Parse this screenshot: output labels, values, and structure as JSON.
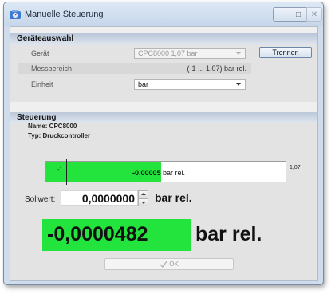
{
  "window": {
    "title": "Manuelle Steuerung",
    "icon": "gauge-app-icon",
    "controls": {
      "minimize": "−",
      "maximize": "□",
      "close": "✕"
    }
  },
  "device_selection": {
    "section_title": "Geräteauswahl",
    "device_label": "Gerät",
    "device_value": "CPC8000 1,07 bar",
    "disconnect_button": "Trennen",
    "range_label": "Messbereich",
    "range_value": "(-1 ... 1,07) bar rel.",
    "unit_label": "Einheit",
    "unit_value": "bar"
  },
  "control": {
    "section_title": "Steuerung",
    "name_line": "Name: CPC8000",
    "type_line": "Typ: Druckcontroller",
    "bar": {
      "min_label": "-1",
      "max_label": "1,07",
      "value_number": "-0,00005",
      "value_unit": "bar rel.",
      "fill_fraction": 0.48
    },
    "setpoint": {
      "label": "Sollwert:",
      "value": "0,0000000",
      "unit": "bar rel."
    },
    "reading": {
      "value": "-0,0000482",
      "unit": "bar rel."
    },
    "ok_button": "OK",
    "colors": {
      "indicator": "#22e43c"
    }
  }
}
